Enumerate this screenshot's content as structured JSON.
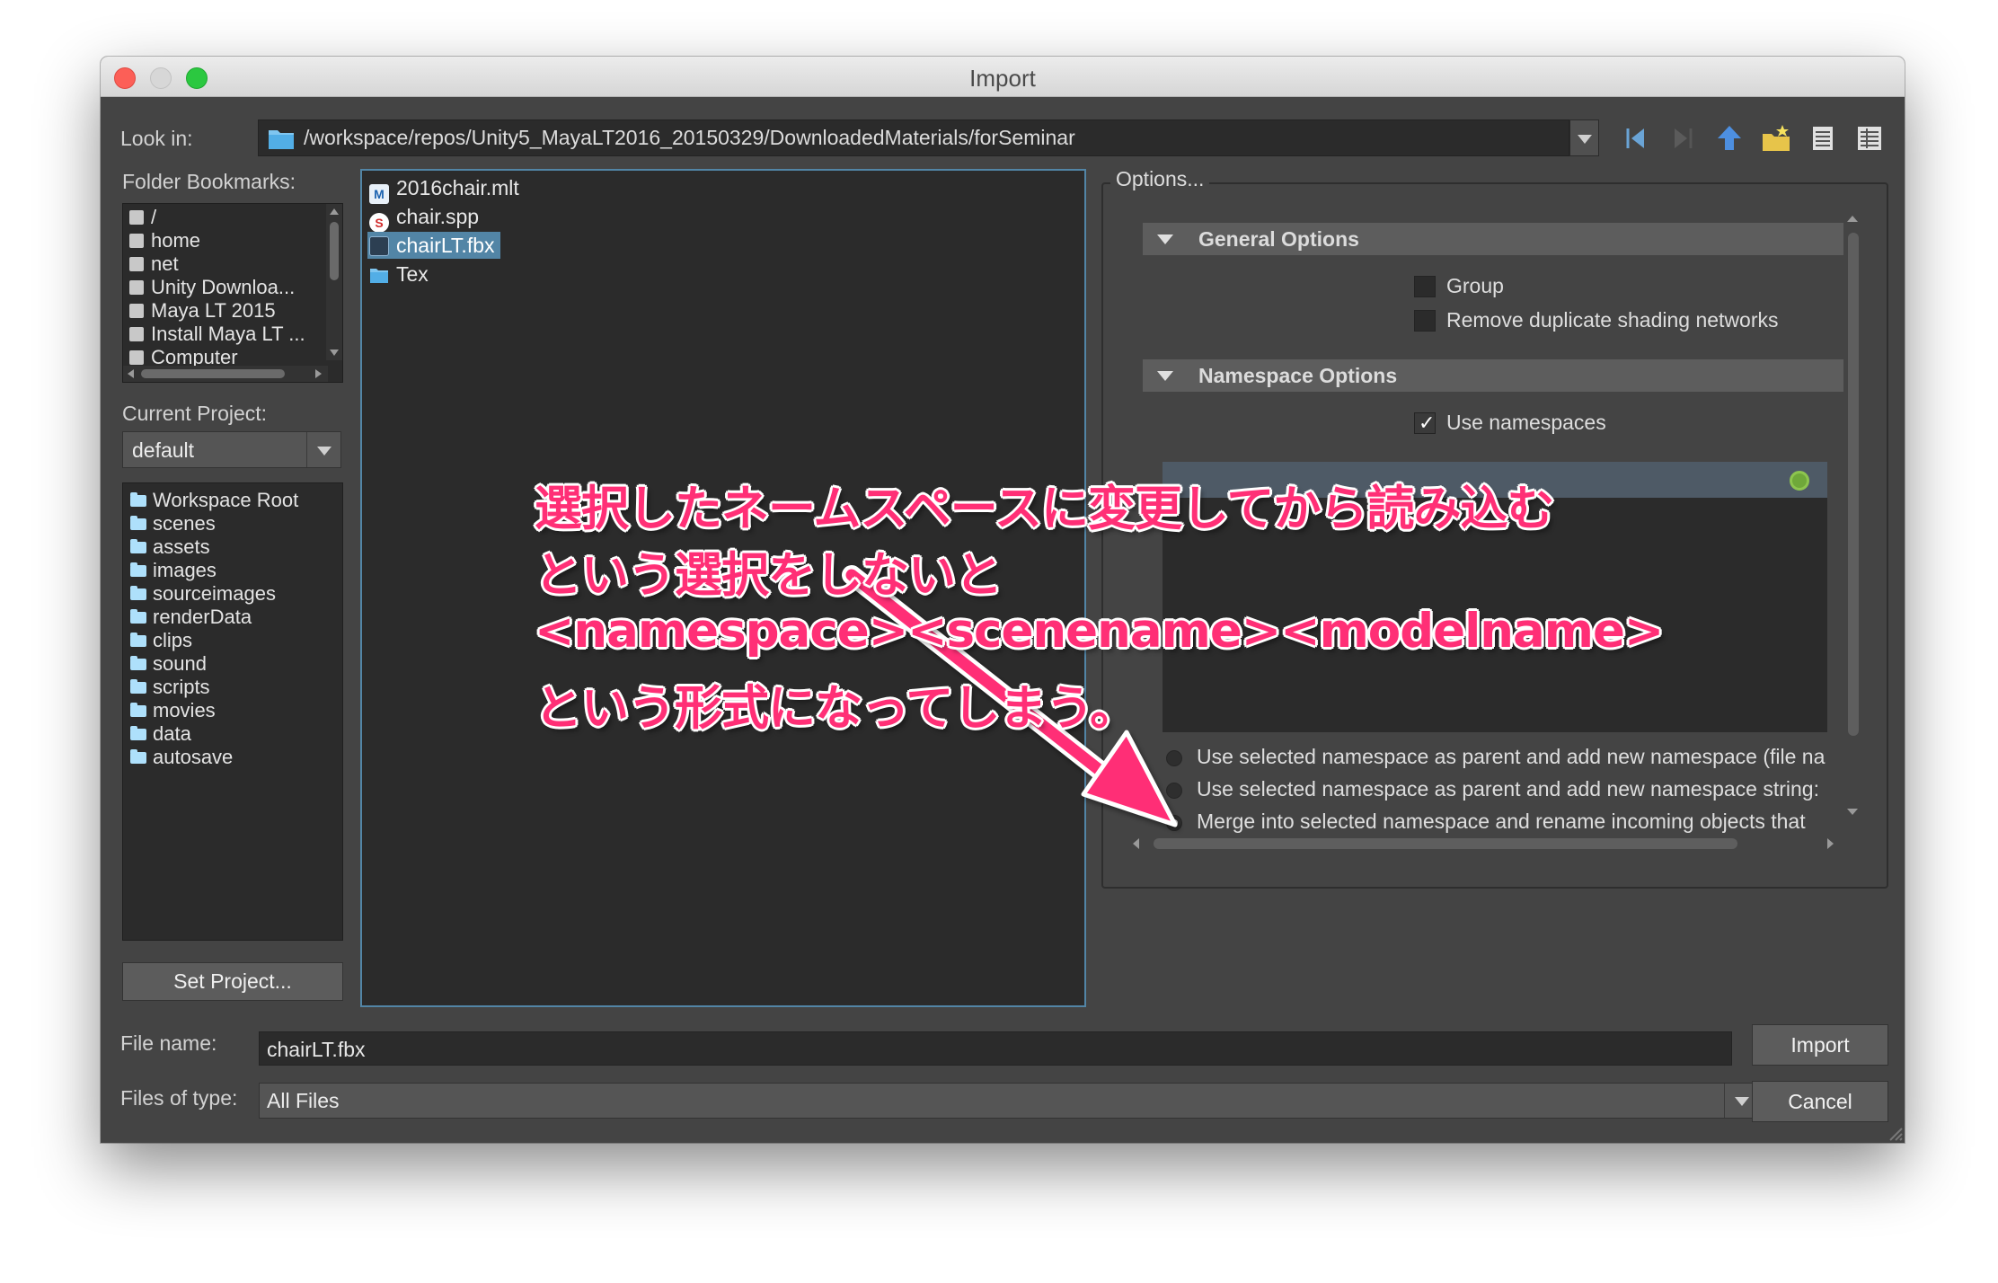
{
  "window": {
    "title": "Import"
  },
  "lookin": {
    "label": "Look in:",
    "path": "/workspace/repos/Unity5_MayaLT2016_20150329/DownloadedMaterials/forSeminar"
  },
  "toolbar": {
    "icons": [
      "back-icon",
      "forward-icon",
      "up-folder-icon",
      "new-folder-icon",
      "list-view-icon",
      "detail-view-icon"
    ]
  },
  "sidebar": {
    "bookmarks_label": "Folder Bookmarks:",
    "bookmarks": [
      "/",
      "home",
      "net",
      "Unity Downloa...",
      "Maya LT 2015",
      "Install Maya LT ...",
      "Computer"
    ],
    "project_label": "Current Project:",
    "project_value": "default",
    "folders": [
      "Workspace Root",
      "scenes",
      "assets",
      "images",
      "sourceimages",
      "renderData",
      "clips",
      "sound",
      "scripts",
      "movies",
      "data",
      "autosave"
    ],
    "set_project": "Set Project..."
  },
  "files": [
    {
      "name": "2016chair.mlt",
      "icon": "mlt-file-icon",
      "selected": false
    },
    {
      "name": "chair.spp",
      "icon": "spp-file-icon",
      "selected": false
    },
    {
      "name": "chairLT.fbx",
      "icon": "fbx-file-icon",
      "selected": true
    },
    {
      "name": "Tex",
      "icon": "folder-icon",
      "selected": false
    }
  ],
  "options": {
    "title": "Options...",
    "general": {
      "header": "General Options",
      "group": {
        "label": "Group",
        "checked": false
      },
      "remove_dup": {
        "label": "Remove duplicate shading networks",
        "checked": false
      }
    },
    "namespace": {
      "header": "Namespace Options",
      "use_ns": {
        "label": "Use namespaces",
        "checked": true
      },
      "radios": [
        {
          "label": "Use selected namespace as parent and add new namespace (file na",
          "selected": false
        },
        {
          "label": "Use selected namespace as parent and add new namespace string:",
          "selected": false
        },
        {
          "label": "Merge into selected namespace and rename incoming objects that",
          "selected": true
        }
      ]
    }
  },
  "footer": {
    "filename_label": "File name:",
    "filename_value": "chairLT.fbx",
    "filetype_label": "Files of type:",
    "filetype_value": "All Files",
    "import_btn": "Import",
    "cancel_btn": "Cancel"
  },
  "annotation": {
    "lines": [
      "選択したネームスペースに変更してから読み込む",
      "という選択をしないと",
      "<namespace><scenename><modelname>",
      "という形式になってしまう。"
    ],
    "color": "#ff2f76"
  }
}
